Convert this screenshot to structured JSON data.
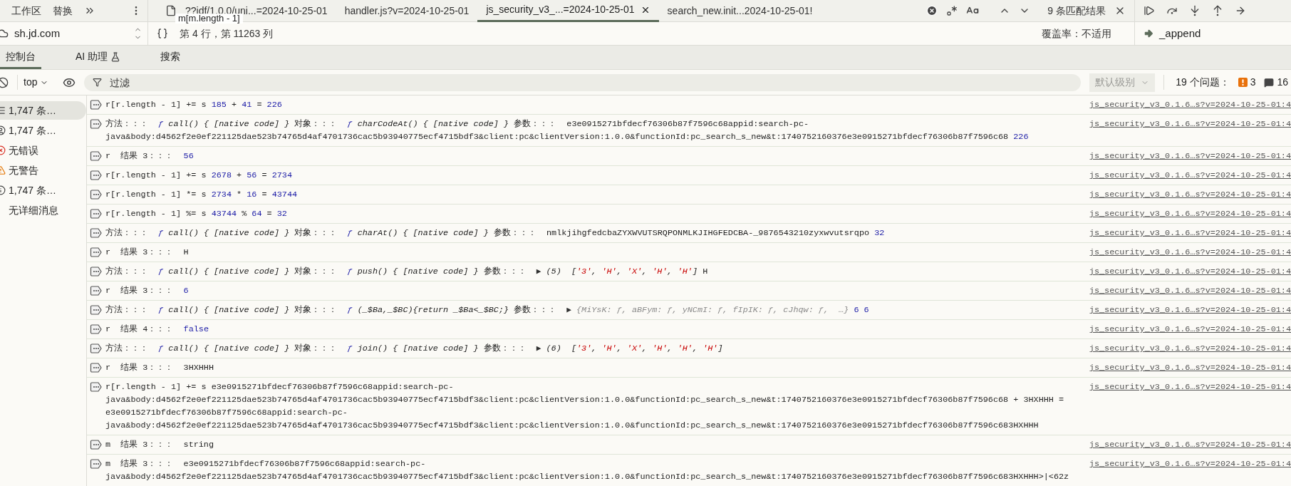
{
  "sources_nav": [
    {
      "label": "工作区",
      "selected": false
    },
    {
      "label": "替换",
      "selected": false
    }
  ],
  "site": "sh.jd.com",
  "editor_tabs": [
    {
      "label": "??idf/1.0.0/uni...=2024-10-25-01",
      "selected": false,
      "file_icon": true
    },
    {
      "label": "handler.js?v=2024-10-25-01",
      "selected": false,
      "file_icon": false
    },
    {
      "label": "js_security_v3_...=2024-10-25-01",
      "selected": true,
      "file_icon": false
    },
    {
      "label": "search_new.init...2024-10-25-01!",
      "selected": false,
      "file_icon": false
    }
  ],
  "tooltip": "m[m.length - 1]",
  "find": {
    "match_count": "9 条匹配结果"
  },
  "cursor_position": "第 4 行，第 11263 列",
  "coverage": "覆盖率：不适用",
  "call_stack": {
    "frame": "_append"
  },
  "drawer_tabs": [
    {
      "label": "控制台",
      "selected": true,
      "experimental": false
    },
    {
      "label": "AI 助理",
      "selected": false,
      "experimental": true
    },
    {
      "label": "搜索",
      "selected": false,
      "experimental": false
    }
  ],
  "toolbar": {
    "context": "top",
    "filter_placeholder": "过滤",
    "level": "默认级别",
    "issues_label": "19 个问题：",
    "errors": "3",
    "messages": "16"
  },
  "sidebar": [
    {
      "label": "1,747 条…",
      "kind": "list",
      "selected": true
    },
    {
      "label": "1,747 条…",
      "kind": "user",
      "selected": false
    },
    {
      "label": "无错误",
      "kind": "error",
      "selected": false
    },
    {
      "label": "无警告",
      "kind": "warning",
      "selected": false
    },
    {
      "label": "1,747 条…",
      "kind": "info",
      "selected": false
    },
    {
      "label": "无详细消息",
      "kind": "verbose",
      "selected": false
    }
  ],
  "messages": [
    {
      "source": "js_security_v3_0.1.6…s?v=2024-10-25-01:4",
      "segments": [
        {
          "kind": "text",
          "text": "r[r.length - 1] += s "
        },
        {
          "kind": "num",
          "text": "185"
        },
        {
          "kind": "text",
          "text": " + "
        },
        {
          "kind": "num",
          "text": "41"
        },
        {
          "kind": "text",
          "text": " = "
        },
        {
          "kind": "num",
          "text": "226"
        }
      ]
    },
    {
      "source": "js_security_v3_0.1.6…s?v=2024-10-25-01:4",
      "segments": [
        {
          "kind": "text",
          "text": "方法：：：  "
        },
        {
          "kind": "fn",
          "text": "ƒ"
        },
        {
          "kind": "sig",
          "text": " call() { [native code] } "
        },
        {
          "kind": "text",
          "text": "对象：：：  "
        },
        {
          "kind": "fn",
          "text": "ƒ"
        },
        {
          "kind": "sig",
          "text": " charCodeAt() { [native code] } "
        },
        {
          "kind": "text",
          "text": "参数：：：  e3e0915271bfdecf76306b87f7596c68appid:search-pc-java&body:d4562f2e0ef221125dae523b74765d4af4701736cac5b93940775ecf4715bdf3&client:pc&clientVersion:1.0.0&functionId:pc_search_s_new&t:1740752160376e3e0915271bfdecf76306b87f7596c68 "
        },
        {
          "kind": "num",
          "text": "226"
        }
      ]
    },
    {
      "source": "js_security_v3_0.1.6…s?v=2024-10-25-01:4",
      "segments": [
        {
          "kind": "text",
          "text": "r  结果 3：：：  "
        },
        {
          "kind": "num",
          "text": "56"
        }
      ]
    },
    {
      "source": "js_security_v3_0.1.6…s?v=2024-10-25-01:4",
      "segments": [
        {
          "kind": "text",
          "text": "r[r.length - 1] += s "
        },
        {
          "kind": "num",
          "text": "2678"
        },
        {
          "kind": "text",
          "text": " + "
        },
        {
          "kind": "num",
          "text": "56"
        },
        {
          "kind": "text",
          "text": " = "
        },
        {
          "kind": "num",
          "text": "2734"
        }
      ]
    },
    {
      "source": "js_security_v3_0.1.6…s?v=2024-10-25-01:4",
      "segments": [
        {
          "kind": "text",
          "text": "r[r.length - 1] *= s "
        },
        {
          "kind": "num",
          "text": "2734"
        },
        {
          "kind": "text",
          "text": " * "
        },
        {
          "kind": "num",
          "text": "16"
        },
        {
          "kind": "text",
          "text": " = "
        },
        {
          "kind": "num",
          "text": "43744"
        }
      ]
    },
    {
      "source": "js_security_v3_0.1.6…s?v=2024-10-25-01:4",
      "segments": [
        {
          "kind": "text",
          "text": "r[r.length - 1] %= s "
        },
        {
          "kind": "num",
          "text": "43744"
        },
        {
          "kind": "text",
          "text": " % "
        },
        {
          "kind": "num",
          "text": "64"
        },
        {
          "kind": "text",
          "text": " = "
        },
        {
          "kind": "num",
          "text": "32"
        }
      ]
    },
    {
      "source": "js_security_v3_0.1.6…s?v=2024-10-25-01:4",
      "segments": [
        {
          "kind": "text",
          "text": "方法：：：  "
        },
        {
          "kind": "fn",
          "text": "ƒ"
        },
        {
          "kind": "sig",
          "text": " call() { [native code] } "
        },
        {
          "kind": "text",
          "text": "对象：：：  "
        },
        {
          "kind": "fn",
          "text": "ƒ"
        },
        {
          "kind": "sig",
          "text": " charAt() { [native code] } "
        },
        {
          "kind": "text",
          "text": "参数：：：  nmlkjihgfedcbaZYXWVUTSRQPONMLKJIHGFEDCBA-_9876543210zyxwvutsrqpo "
        },
        {
          "kind": "num",
          "text": "32"
        }
      ]
    },
    {
      "source": "js_security_v3_0.1.6…s?v=2024-10-25-01:4",
      "segments": [
        {
          "kind": "text",
          "text": "r  结果 3：：：  H"
        }
      ]
    },
    {
      "source": "js_security_v3_0.1.6…s?v=2024-10-25-01:4",
      "segments": [
        {
          "kind": "text",
          "text": "方法：：：  "
        },
        {
          "kind": "fn",
          "text": "ƒ"
        },
        {
          "kind": "sig",
          "text": " call() { [native code] } "
        },
        {
          "kind": "text",
          "text": "对象：：：  "
        },
        {
          "kind": "fn",
          "text": "ƒ"
        },
        {
          "kind": "sig",
          "text": " push() { [native code] } "
        },
        {
          "kind": "text",
          "text": "参数：：：  "
        },
        {
          "kind": "toggle",
          "text": "▶"
        },
        {
          "kind": "sig",
          "text": " (5)  ["
        },
        {
          "kind": "str",
          "text": "'3'"
        },
        {
          "kind": "sig",
          "text": ", "
        },
        {
          "kind": "str",
          "text": "'H'"
        },
        {
          "kind": "sig",
          "text": ", "
        },
        {
          "kind": "str",
          "text": "'X'"
        },
        {
          "kind": "sig",
          "text": ", "
        },
        {
          "kind": "str",
          "text": "'H'"
        },
        {
          "kind": "sig",
          "text": ", "
        },
        {
          "kind": "str",
          "text": "'H'"
        },
        {
          "kind": "sig",
          "text": "]"
        },
        {
          "kind": "text",
          "text": " H"
        }
      ]
    },
    {
      "source": "js_security_v3_0.1.6…s?v=2024-10-25-01:4",
      "segments": [
        {
          "kind": "text",
          "text": "r  结果 3：：：  "
        },
        {
          "kind": "num",
          "text": "6"
        }
      ]
    },
    {
      "source": "js_security_v3_0.1.6…s?v=2024-10-25-01:4",
      "segments": [
        {
          "kind": "text",
          "text": "方法：：：  "
        },
        {
          "kind": "fn",
          "text": "ƒ"
        },
        {
          "kind": "sig",
          "text": " call() { [native code] } "
        },
        {
          "kind": "text",
          "text": "对象：：：  "
        },
        {
          "kind": "fn",
          "text": "ƒ"
        },
        {
          "kind": "sig",
          "text": " (_$Ba,_$BC){return _$Ba<_$BC;} "
        },
        {
          "kind": "text",
          "text": "参数：：：  "
        },
        {
          "kind": "toggle",
          "text": "▶"
        },
        {
          "kind": "dim",
          "text": " {MiYsK: ƒ, aBFym: ƒ, yNCmI: ƒ, fIpIK: ƒ, cJhqw: ƒ,  …} "
        },
        {
          "kind": "num",
          "text": "6 6"
        }
      ]
    },
    {
      "source": "js_security_v3_0.1.6…s?v=2024-10-25-01:4",
      "segments": [
        {
          "kind": "text",
          "text": "r  结果 4：：：  "
        },
        {
          "kind": "num",
          "text": "false"
        }
      ]
    },
    {
      "source": "js_security_v3_0.1.6…s?v=2024-10-25-01:4",
      "segments": [
        {
          "kind": "text",
          "text": "方法：：：  "
        },
        {
          "kind": "fn",
          "text": "ƒ"
        },
        {
          "kind": "sig",
          "text": " call() { [native code] } "
        },
        {
          "kind": "text",
          "text": "对象：：：  "
        },
        {
          "kind": "fn",
          "text": "ƒ"
        },
        {
          "kind": "sig",
          "text": " join() { [native code] } "
        },
        {
          "kind": "text",
          "text": "参数：：：  "
        },
        {
          "kind": "toggle",
          "text": "▶"
        },
        {
          "kind": "sig",
          "text": " (6)  ["
        },
        {
          "kind": "str",
          "text": "'3'"
        },
        {
          "kind": "sig",
          "text": ", "
        },
        {
          "kind": "str",
          "text": "'H'"
        },
        {
          "kind": "sig",
          "text": ", "
        },
        {
          "kind": "str",
          "text": "'X'"
        },
        {
          "kind": "sig",
          "text": ", "
        },
        {
          "kind": "str",
          "text": "'H'"
        },
        {
          "kind": "sig",
          "text": ", "
        },
        {
          "kind": "str",
          "text": "'H'"
        },
        {
          "kind": "sig",
          "text": ", "
        },
        {
          "kind": "str",
          "text": "'H'"
        },
        {
          "kind": "sig",
          "text": "]"
        }
      ]
    },
    {
      "source": "js_security_v3_0.1.6…s?v=2024-10-25-01:4",
      "segments": [
        {
          "kind": "text",
          "text": "r  结果 3：：：  3HXHHH"
        }
      ]
    },
    {
      "source": "js_security_v3_0.1.6…s?v=2024-10-25-01:4",
      "segments": [
        {
          "kind": "text",
          "text": "r[r.length - 1] += s e3e0915271bfdecf76306b87f7596c68appid:search-pc-java&body:d4562f2e0ef221125dae523b74765d4af4701736cac5b93940775ecf4715bdf3&client:pc&clientVersion:1.0.0&functionId:pc_search_s_new&t:1740752160376e3e0915271bfdecf76306b87f7596c68 + 3HXHHH = e3e0915271bfdecf76306b87f7596c68appid:search-pc-java&body:d4562f2e0ef221125dae523b74765d4af4701736cac5b93940775ecf4715bdf3&client:pc&clientVersion:1.0.0&functionId:pc_search_s_new&t:1740752160376e3e0915271bfdecf76306b87f7596c683HXHHH"
        }
      ]
    },
    {
      "source": "js_security_v3_0.1.6…s?v=2024-10-25-01:4",
      "segments": [
        {
          "kind": "text",
          "text": "m  结果 3：：：  string"
        }
      ]
    },
    {
      "source": "js_security_v3_0.1.6…s?v=2024-10-25-01:4",
      "segments": [
        {
          "kind": "text",
          "text": "m  结果 3：：：  e3e0915271bfdecf76306b87f7596c68appid:search-pc-java&body:d4562f2e0ef221125dae523b74765d4af4701736cac5b93940775ecf4715bdf3&client:pc&clientVersion:1.0.0&functionId:pc_search_s_new&t:1740752160376e3e0915271bfdecf76306b87f7596c683HXHHH>|<62z"
        }
      ]
    }
  ]
}
